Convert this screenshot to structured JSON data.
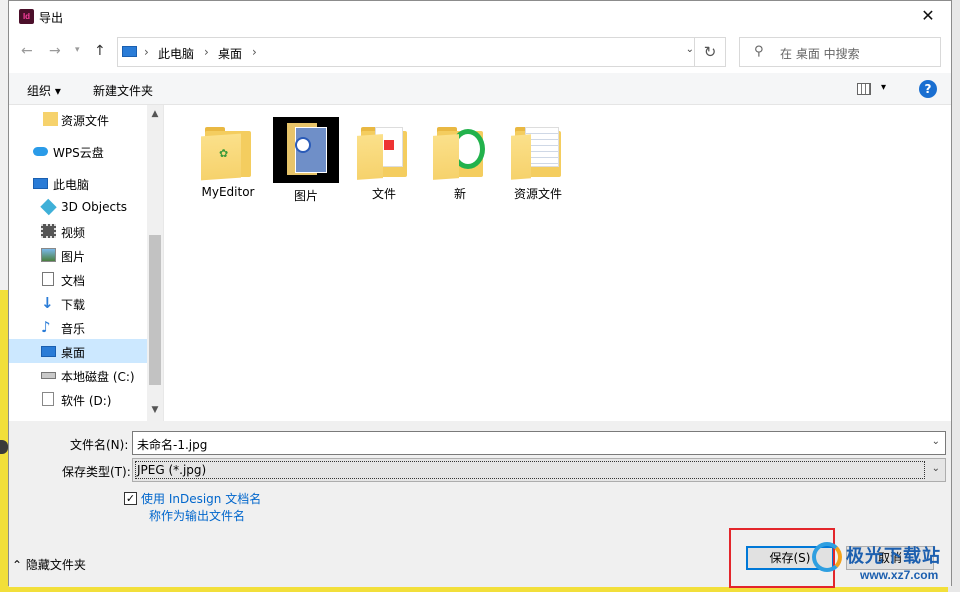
{
  "window": {
    "title": "导出",
    "app_icon_text": "Id"
  },
  "address": {
    "crumbs": [
      "此电脑",
      "桌面"
    ],
    "search_placeholder": "在 桌面 中搜索"
  },
  "toolbar": {
    "organize": "组织 ▾",
    "new_folder": "新建文件夹",
    "help": "?"
  },
  "nav": [
    {
      "label": "资源文件",
      "icon": "folder-icon"
    },
    {
      "label": "WPS云盘",
      "icon": "cloud-icon"
    },
    {
      "label": "此电脑",
      "icon": "computer-icon"
    },
    {
      "label": "3D Objects",
      "icon": "cube-icon"
    },
    {
      "label": "视频",
      "icon": "video-icon"
    },
    {
      "label": "图片",
      "icon": "picture-icon"
    },
    {
      "label": "文档",
      "icon": "document-icon"
    },
    {
      "label": "下载",
      "icon": "download-icon"
    },
    {
      "label": "音乐",
      "icon": "music-icon"
    },
    {
      "label": "桌面",
      "icon": "desktop-icon",
      "selected": true
    },
    {
      "label": "本地磁盘 (C:)",
      "icon": "drive-icon"
    },
    {
      "label": "软件 (D:)",
      "icon": "drive-icon"
    }
  ],
  "files": [
    "MyEditor",
    "图片",
    "文件",
    "新",
    "资源文件"
  ],
  "form": {
    "filename_label": "文件名(N):",
    "filename_value": "未命名-1.jpg",
    "filetype_label": "保存类型(T):",
    "filetype_value": "JPEG (*.jpg)",
    "checkbox_checked": true,
    "checkbox_line1": "使用 InDesign 文档名",
    "checkbox_line2": "称作为输出文件名",
    "hide_folders": "隐藏文件夹",
    "save": "保存(S)",
    "cancel": "取消"
  },
  "watermark": {
    "title": "极光下载站",
    "url": "www.xz7.com"
  },
  "colors": {
    "accent": "#0078d7",
    "selection": "#cce8ff",
    "highlight": "#e3262b"
  }
}
